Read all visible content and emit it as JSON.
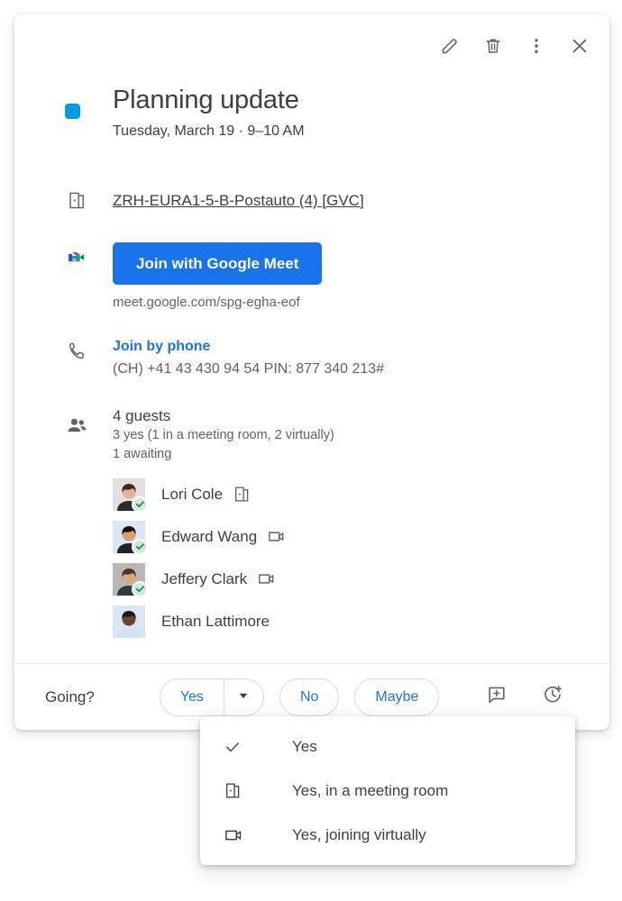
{
  "header": {
    "actions": [
      {
        "name": "edit-event-button",
        "icon": "pencil-icon",
        "label": "Edit event"
      },
      {
        "name": "delete-event-button",
        "icon": "trash-icon",
        "label": "Delete event"
      },
      {
        "name": "more-options-button",
        "icon": "more-vertical-icon",
        "label": "More options"
      },
      {
        "name": "close-button",
        "icon": "close-icon",
        "label": "Close"
      }
    ]
  },
  "event": {
    "calendar_color": "#039BE5",
    "title": "Planning update",
    "when": "Tuesday, March 19  ·  9–10 AM"
  },
  "room": {
    "icon": "meeting-room-icon",
    "name": "ZRH-EURA1-5-B-Postauto (4) [GVC]"
  },
  "meet": {
    "icon": "google-meet-icon",
    "button_label": "Join with Google Meet",
    "url": "meet.google.com/spg-egha-eof",
    "button_color": "#1a73e8"
  },
  "phone": {
    "icon": "phone-icon",
    "link_label": "Join by phone",
    "details": "(CH) +41 43 430 94 54 PIN: 877 340 213#",
    "link_color": "#1a73e8"
  },
  "guests": {
    "icon": "people-icon",
    "count_label": "4 guests",
    "status_yes": "3 yes (1 in a meeting room, 2 virtually)",
    "status_awaiting": "1 awaiting",
    "list": [
      {
        "name": "Lori Cole",
        "rsvp": "yes",
        "mode": "meeting-room",
        "avatar_bg": "#e3e0de",
        "skin": "#e3b394",
        "hair": "#3b2a22",
        "shirt": "#2b2b2f"
      },
      {
        "name": "Edward Wang",
        "rsvp": "yes",
        "mode": "virtual",
        "avatar_bg": "#dce7f5",
        "skin": "#d9a06e",
        "hair": "#16120f",
        "shirt": "#23242a"
      },
      {
        "name": "Jeffery Clark",
        "rsvp": "yes",
        "mode": "virtual",
        "avatar_bg": "#b9b6b3",
        "skin": "#dca87c",
        "hair": "#4a3328",
        "shirt": "#2f3a45"
      },
      {
        "name": "Ethan Lattimore",
        "rsvp": "awaiting",
        "mode": "none",
        "avatar_bg": "#d9e7f3",
        "skin": "#6b4430",
        "hair": "#1d1512",
        "shirt": "#cfe4f2"
      }
    ],
    "badge_color": "#ceead6",
    "badge_check_color": "#1e8e3e"
  },
  "footer": {
    "going_label": "Going?",
    "yes_label": "Yes",
    "no_label": "No",
    "maybe_label": "Maybe",
    "dropdown_icon": "chevron-down-icon",
    "comment_icon": "add-comment-icon",
    "propose_time_icon": "propose-new-time-icon"
  },
  "menu": {
    "items": [
      {
        "icon": "check-icon",
        "label": "Yes",
        "selected": true
      },
      {
        "icon": "meeting-room-icon",
        "label": "Yes, in a meeting room",
        "selected": false
      },
      {
        "icon": "video-camera-icon",
        "label": "Yes, joining virtually",
        "selected": false
      }
    ]
  }
}
